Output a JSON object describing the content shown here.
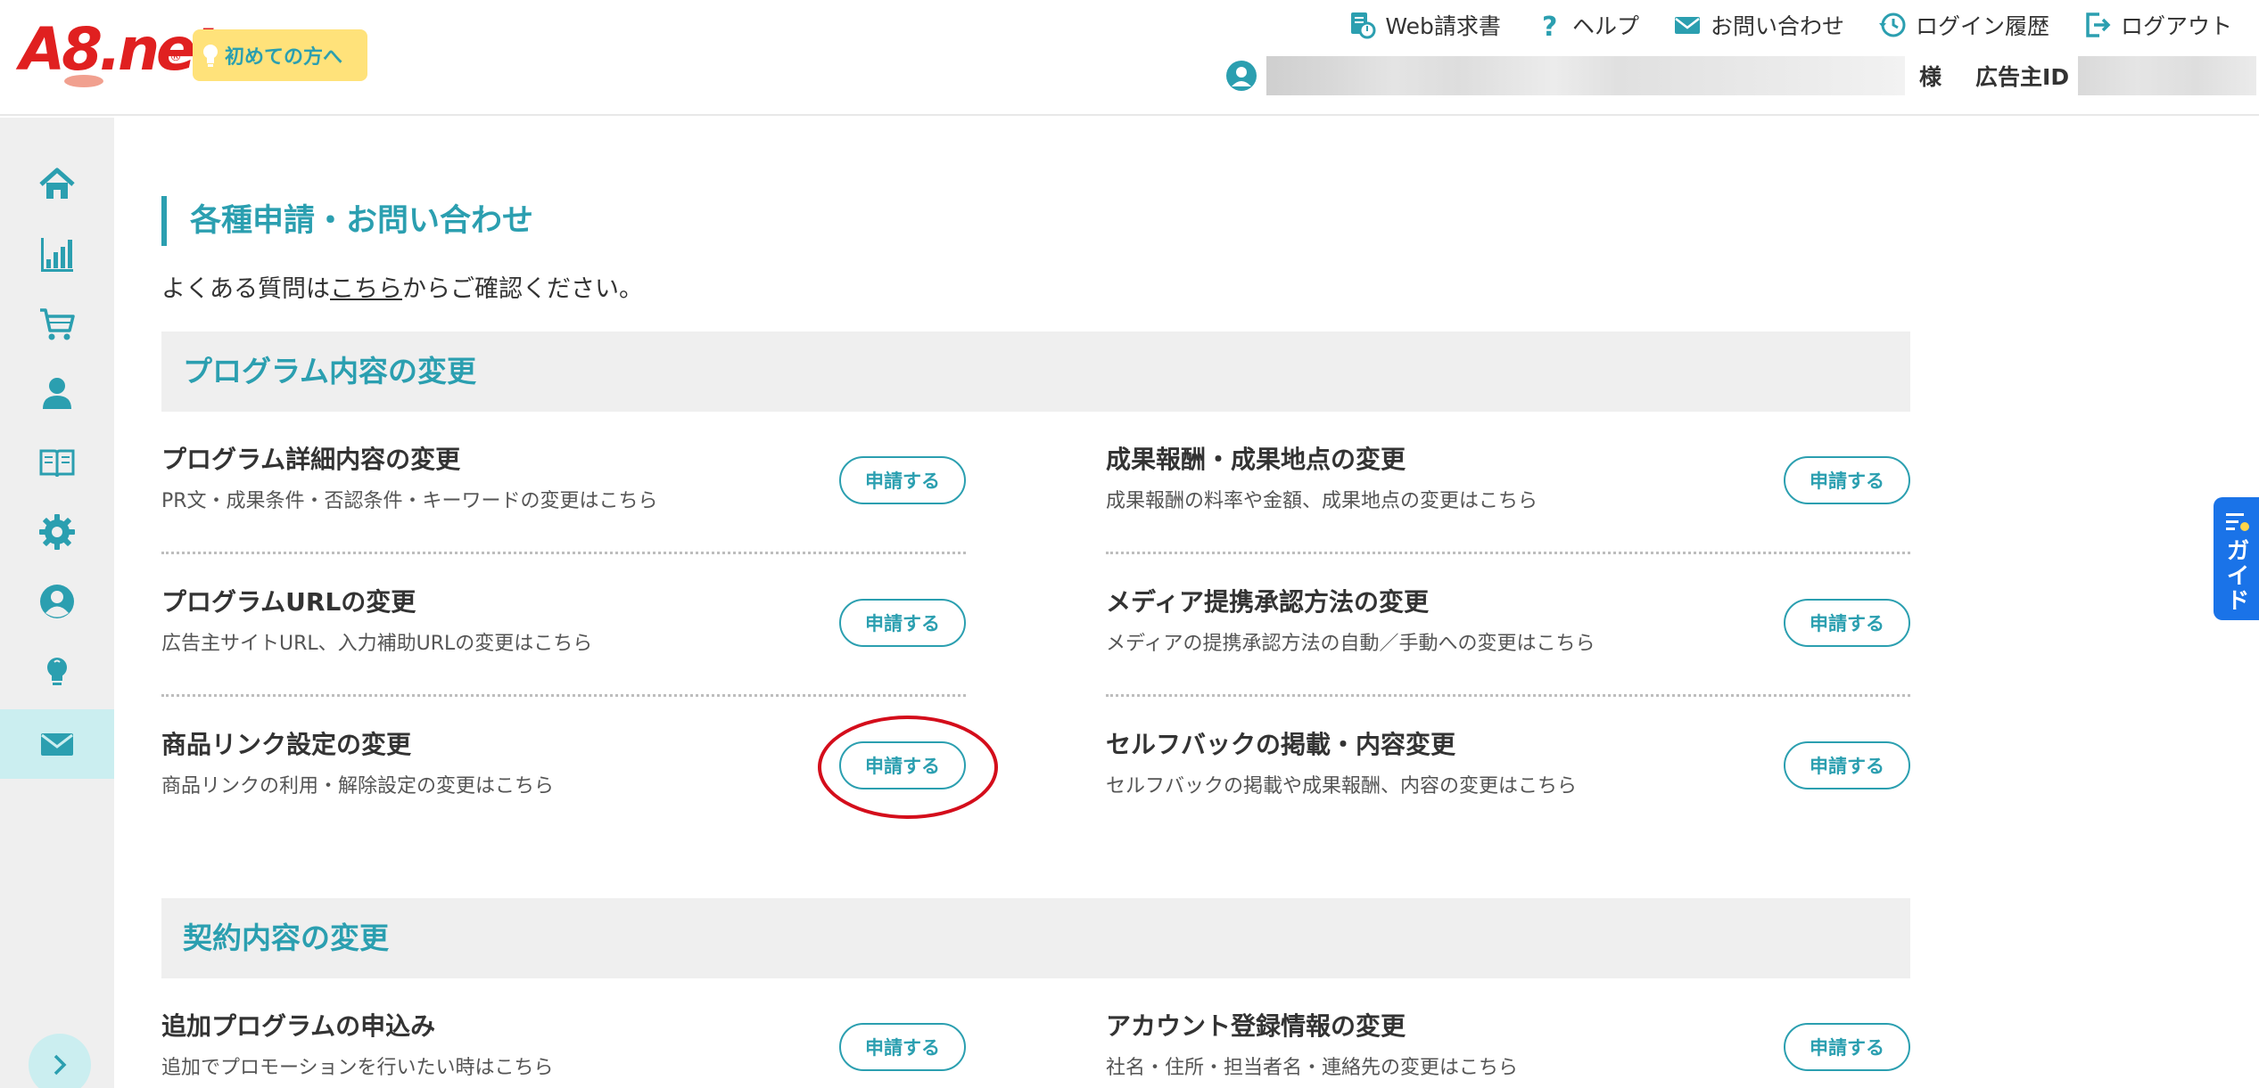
{
  "header": {
    "logo_text": "A8.net",
    "first_time_label": "初めての方へ",
    "links": {
      "invoice": "Web請求書",
      "help": "ヘルプ",
      "contact": "お問い合わせ",
      "login_history": "ログイン履歴",
      "logout": "ログアウト"
    },
    "user_suffix": "様",
    "advertiser_id_label": "広告主ID"
  },
  "sidebar": {
    "items": [
      "home-icon",
      "chart-icon",
      "cart-icon",
      "person-icon",
      "book-icon",
      "gear-icon",
      "account-icon",
      "lightbulb-icon",
      "mail-icon"
    ],
    "active": "mail-icon",
    "accent": "#2b9fb0"
  },
  "main": {
    "page_title": "各種申請・お問い合わせ",
    "faq": {
      "before": "よくある質問は",
      "link": "こちら",
      "after": "からご確認ください。"
    },
    "sections": [
      {
        "title": "プログラム内容の変更",
        "items": [
          {
            "title": "プログラム詳細内容の変更",
            "desc": "PR文・成果条件・否認条件・キーワードの変更はこちら",
            "button": "申請する"
          },
          {
            "title": "成果報酬・成果地点の変更",
            "desc": "成果報酬の料率や金額、成果地点の変更はこちら",
            "button": "申請する"
          },
          {
            "title": "プログラムURLの変更",
            "desc": "広告主サイトURL、入力補助URLの変更はこちら",
            "button": "申請する"
          },
          {
            "title": "メディア提携承認方法の変更",
            "desc": "メディアの提携承認方法の自動／手動への変更はこちら",
            "button": "申請する"
          },
          {
            "title": "商品リンク設定の変更",
            "desc": "商品リンクの利用・解除設定の変更はこちら",
            "button": "申請する"
          },
          {
            "title": "セルフバックの掲載・内容変更",
            "desc": "セルフバックの掲載や成果報酬、内容の変更はこちら",
            "button": "申請する"
          }
        ]
      },
      {
        "title": "契約内容の変更",
        "items": [
          {
            "title": "追加プログラムの申込み",
            "desc": "追加でプロモーションを行いたい時はこちら",
            "button": "申請する"
          },
          {
            "title": "アカウント登録情報の変更",
            "desc": "社名・住所・担当者名・連絡先の変更はこちら",
            "button": "申請する"
          }
        ]
      }
    ]
  },
  "guide": {
    "label": "ガイド",
    "color": "#1a73e8"
  },
  "highlight_color": "#d40d1b"
}
